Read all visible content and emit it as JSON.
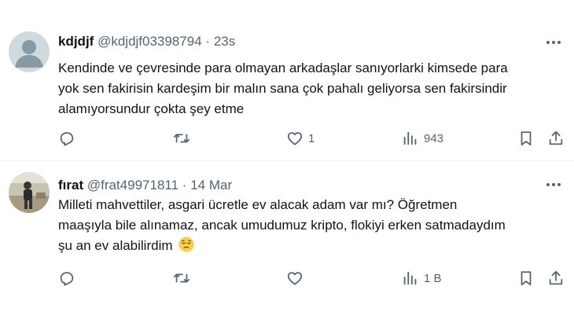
{
  "tweets": [
    {
      "name": "kdjdjf",
      "handle": "@kdjdjf03398794",
      "separator": "·",
      "time": "23s",
      "text": "Kendinde ve çevresinde para olmayan arkadaşlar sanıyorlarki kimsede para\nyok sen fakirisin kardeşim bir malın sana çok pahalı geliyorsa sen fakirsindir\nalamıyorsundur çokta şey etme",
      "avatar_icon": "default-profile-icon",
      "actions": {
        "reply_count": "",
        "repost_count": "",
        "like_count": "1",
        "views_count": "943"
      }
    },
    {
      "name": "fırat",
      "handle": "@frat49971811",
      "separator": "·",
      "time": "14 Mar",
      "text": "Milleti mahvettiler, asgari ücretle ev alacak adam var mı? Öğretmen\nmaaşıyla bile alınamaz, ancak umudumuz kripto, flokiyi erken satmadaydım\nşu an ev alabilirdim",
      "emoji": "😔",
      "avatar_icon": "photo-avatar",
      "actions": {
        "reply_count": "",
        "repost_count": "",
        "like_count": "",
        "views_count": "1 B"
      }
    }
  ],
  "colors": {
    "text_primary": "#0f1419",
    "text_secondary": "#536471",
    "divider": "#eff3f4",
    "default_avatar_bg": "#cfd9de"
  }
}
